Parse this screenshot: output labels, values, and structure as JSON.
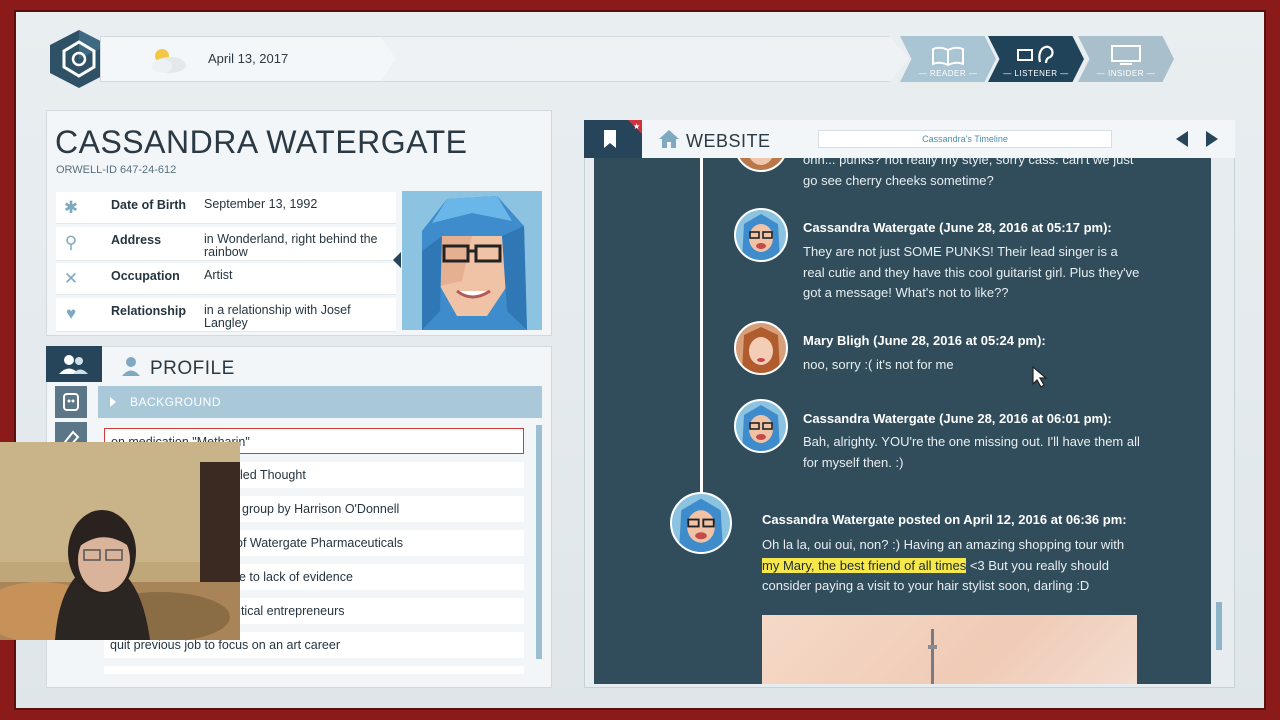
{
  "top": {
    "date": "April 13, 2017",
    "modes": [
      {
        "label": "— READER —",
        "icon": "book-icon"
      },
      {
        "label": "— LISTENER —",
        "icon": "ear-icon"
      },
      {
        "label": "— INSIDER —",
        "icon": "monitor-icon"
      }
    ]
  },
  "person": {
    "name": "CASSANDRA WATERGATE",
    "orwell_id": "ORWELL-ID  647-24-612",
    "fields": [
      {
        "icon": "asterisk-icon",
        "key": "Date of Birth",
        "value": "September 13, 1992"
      },
      {
        "icon": "location-pin-icon",
        "key": "Address",
        "value": "in Wonderland, right behind the rainbow"
      },
      {
        "icon": "tools-icon",
        "key": "Occupation",
        "value": "Artist"
      },
      {
        "icon": "heart-icon",
        "key": "Relationship",
        "value": "in a relationship with Josef Langley"
      }
    ]
  },
  "profile": {
    "title": "PROFILE",
    "section": "BACKGROUND",
    "items": [
      "on medication \"Metharin\"",
      "led Thought",
      "group by Harrison O'Donnell",
      "of Watergate Pharmaceuticals",
      "ue to lack of evidence",
      "utical entrepreneurs",
      "quit previous job to focus on an art career"
    ]
  },
  "website": {
    "label": "WEBSITE",
    "timeline_title": "Cassandra's Timeline",
    "posts": [
      {
        "author": "",
        "body": "ohh... punks? not really my style, sorry cass. can't we just go see cherry cheeks sometime?"
      },
      {
        "author": "Cassandra Watergate (June 28, 2016 at 05:17 pm):",
        "body": "They are not just SOME PUNKS! Their lead singer is a real cutie and they have this cool guitarist girl. Plus they've got a message! What's not to like??"
      },
      {
        "author": "Mary Bligh (June 28, 2016 at 05:24 pm):",
        "body": "noo, sorry :( it's not for me"
      },
      {
        "author": "Cassandra Watergate (June 28, 2016 at 06:01 pm):",
        "body": "Bah, alrighty. YOU're the one missing out. I'll have them all for myself then. :)"
      }
    ],
    "main_post": {
      "author": "Cassandra Watergate posted on April 12, 2016 at 06:36 pm:",
      "body_pre": "Oh la la, oui oui, non? :) Having an amazing shopping tour with ",
      "highlight": "my Mary, the best friend of all times",
      "body_post": " <3 But you really should consider paying a visit to your hair stylist soon, darling :D"
    }
  },
  "colors": {
    "frame_red": "#8b1a1a",
    "navy": "#27455a",
    "feed_bg": "#314d5b",
    "highlight": "#f6e84a"
  }
}
